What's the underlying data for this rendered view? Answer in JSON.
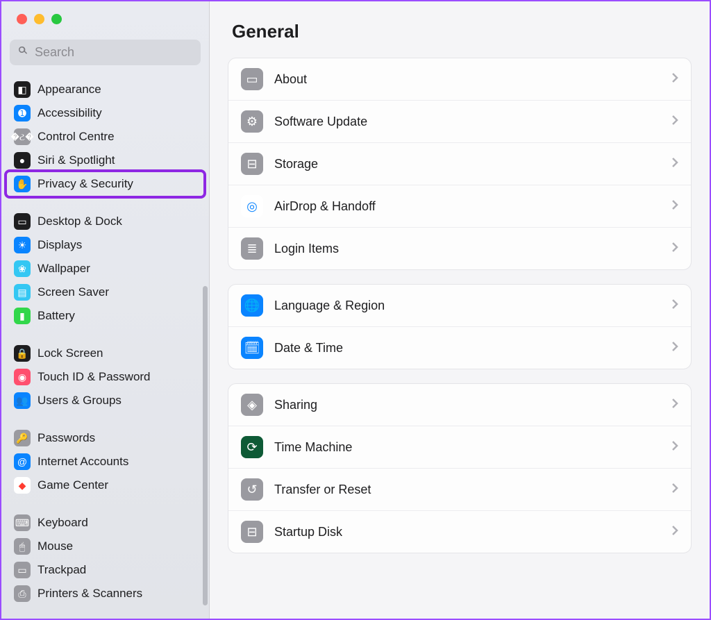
{
  "search": {
    "placeholder": "Search"
  },
  "sidebar": {
    "groups": [
      [
        {
          "label": "Appearance",
          "icon": "◧",
          "bg": "#1d1d1f"
        },
        {
          "label": "Accessibility",
          "icon": "➊",
          "bg": "#0a84ff"
        },
        {
          "label": "Control Centre",
          "icon": "�ટ�",
          "bg": "#9a9aa0"
        },
        {
          "label": "Siri & Spotlight",
          "icon": "●",
          "bg": "#1d1d1f"
        },
        {
          "label": "Privacy & Security",
          "icon": "✋",
          "bg": "#0a84ff",
          "highlighted": true
        }
      ],
      [
        {
          "label": "Desktop & Dock",
          "icon": "▭",
          "bg": "#1d1d1f"
        },
        {
          "label": "Displays",
          "icon": "☀",
          "bg": "#0a84ff"
        },
        {
          "label": "Wallpaper",
          "icon": "❀",
          "bg": "#34c7f3"
        },
        {
          "label": "Screen Saver",
          "icon": "▤",
          "bg": "#34c7f3"
        },
        {
          "label": "Battery",
          "icon": "▮",
          "bg": "#32d74b"
        }
      ],
      [
        {
          "label": "Lock Screen",
          "icon": "🔒",
          "bg": "#1d1d1f"
        },
        {
          "label": "Touch ID & Password",
          "icon": "◉",
          "bg": "#ff4f6e"
        },
        {
          "label": "Users & Groups",
          "icon": "👥",
          "bg": "#0a84ff"
        }
      ],
      [
        {
          "label": "Passwords",
          "icon": "🔑",
          "bg": "#9a9aa0"
        },
        {
          "label": "Internet Accounts",
          "icon": "@",
          "bg": "#0a84ff"
        },
        {
          "label": "Game Center",
          "icon": "◆",
          "bg": "#ffffff"
        }
      ],
      [
        {
          "label": "Keyboard",
          "icon": "⌨",
          "bg": "#9a9aa0"
        },
        {
          "label": "Mouse",
          "icon": "🖱",
          "bg": "#9a9aa0"
        },
        {
          "label": "Trackpad",
          "icon": "▭",
          "bg": "#9a9aa0"
        },
        {
          "label": "Printers & Scanners",
          "icon": "⎙",
          "bg": "#9a9aa0"
        }
      ]
    ]
  },
  "page": {
    "title": "General",
    "groups": [
      [
        {
          "label": "About",
          "icon": "▭",
          "bg": "#9a9aa0"
        },
        {
          "label": "Software Update",
          "icon": "⚙",
          "bg": "#9a9aa0"
        },
        {
          "label": "Storage",
          "icon": "⊟",
          "bg": "#9a9aa0"
        },
        {
          "label": "AirDrop & Handoff",
          "icon": "◎",
          "bg": "#ffffff",
          "fg": "#0a84ff"
        },
        {
          "label": "Login Items",
          "icon": "≣",
          "bg": "#9a9aa0"
        }
      ],
      [
        {
          "label": "Language & Region",
          "icon": "🌐",
          "bg": "#0a84ff"
        },
        {
          "label": "Date & Time",
          "icon": "🗓",
          "bg": "#0a84ff"
        }
      ],
      [
        {
          "label": "Sharing",
          "icon": "◈",
          "bg": "#9a9aa0"
        },
        {
          "label": "Time Machine",
          "icon": "⟳",
          "bg": "#0e5a36"
        },
        {
          "label": "Transfer or Reset",
          "icon": "↺",
          "bg": "#9a9aa0"
        },
        {
          "label": "Startup Disk",
          "icon": "⊟",
          "bg": "#9a9aa0"
        }
      ]
    ]
  }
}
